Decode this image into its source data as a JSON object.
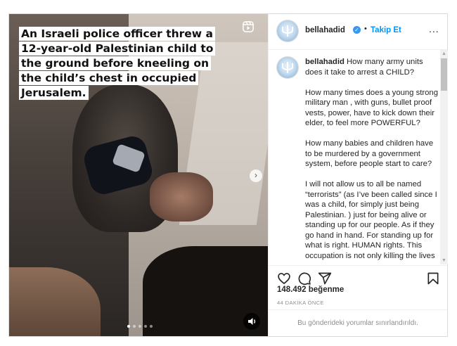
{
  "post": {
    "caption_overlay": "An Israeli police officer threw a 12-year-old Palestinian child to the ground before kneeling on the child’s chest in occupied Jerusalem.",
    "carousel": {
      "total": 5,
      "active": 0
    }
  },
  "header": {
    "username": "bellahadid",
    "verified_icon": "verified-badge-icon",
    "separator": "•",
    "follow_label": "Takip Et",
    "more_label": "..."
  },
  "caption": {
    "username": "bellahadid",
    "paragraphs": [
      "How many army units does it take to arrest a CHILD?",
      "How many times does a young strong military man , with guns, bullet proof vests, power, have to kick down their elder, to feel more POWERFUL?",
      "How many babies and children have to be murdered by a government system, before people start to care?",
      "I will not allow us to all be named “terrorists” (as I’ve been called since I was a child, for simply just being Palestinian. ) just for being alive or standing up for our people. As if they go hand in hand. For standing up for what is right. HUMAN rights. This occupation is not only killing the lives"
    ]
  },
  "stats": {
    "likes": "148.492 beğenme",
    "timestamp": "44 DAKİKA ÖNCE"
  },
  "footer": {
    "restricted_text": "Bu gönderideki yorumlar sınırlandırıldı."
  },
  "colors": {
    "link": "#0095f6",
    "verified": "#3897f0",
    "text": "#262626",
    "muted": "#8e8e8e"
  },
  "icons": [
    "reel-icon",
    "next-arrow-icon",
    "sound-icon",
    "heart-icon",
    "comment-icon",
    "share-icon",
    "bookmark-icon"
  ]
}
